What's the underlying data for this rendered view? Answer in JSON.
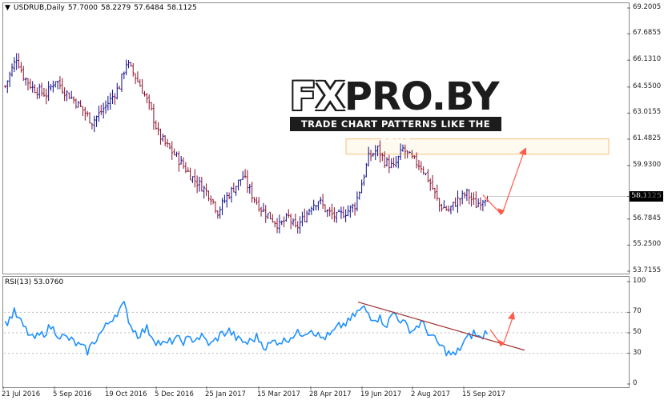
{
  "header": {
    "symbol": "USDRUB,Daily",
    "open": "57.7000",
    "high": "58.2279",
    "low": "57.6484",
    "close": "58.1125"
  },
  "rsi_header": {
    "label": "RSI(13) 53.0760"
  },
  "logo": {
    "main_left": "FX",
    "main_right": "PRO.BY",
    "tagline": "TRADE CHART PATTERNS LIKE THE PROS"
  },
  "price_tag": "58.1125",
  "colors": {
    "bull": "#0b0b8f",
    "bear": "#8b0f2c",
    "rsi": "#1e90ff",
    "trendline": "#a03030",
    "arrow": "#ff5a4a",
    "zone": "#f5c07a"
  },
  "chart_data": [
    {
      "type": "ohlc",
      "symbol": "USDRUB",
      "timeframe": "Daily",
      "ylim": [
        53.7155,
        69.2005
      ],
      "y_ticks": [
        "69.2005",
        "67.6855",
        "66.1310",
        "64.5500",
        "63.0155",
        "61.4825",
        "59.9300",
        "58.1125",
        "56.7845",
        "55.2500",
        "53.7155"
      ],
      "x_ticks": [
        "21 Jul 2016",
        "5 Sep 2016",
        "19 Oct 2016",
        "5 Dec 2016",
        "25 Jan 2017",
        "15 Mar 2017",
        "28 Apr 2017",
        "19 Jun 2017",
        "2 Aug 2017",
        "15 Sep 2017"
      ],
      "close_profile": [
        [
          0,
          64.6
        ],
        [
          5,
          66.3
        ],
        [
          8,
          65.2
        ],
        [
          12,
          64.5
        ],
        [
          18,
          64.1
        ],
        [
          22,
          65.0
        ],
        [
          26,
          64.3
        ],
        [
          30,
          63.8
        ],
        [
          34,
          63.2
        ],
        [
          38,
          62.5
        ],
        [
          42,
          63.1
        ],
        [
          46,
          63.8
        ],
        [
          50,
          64.6
        ],
        [
          53,
          66.0
        ],
        [
          56,
          65.4
        ],
        [
          60,
          64.4
        ],
        [
          64,
          63.1
        ],
        [
          67,
          61.8
        ],
        [
          70,
          61.2
        ],
        [
          74,
          60.6
        ],
        [
          78,
          59.9
        ],
        [
          82,
          59.2
        ],
        [
          86,
          58.7
        ],
        [
          90,
          58.1
        ],
        [
          93,
          57.2
        ],
        [
          97,
          58.1
        ],
        [
          100,
          58.6
        ],
        [
          104,
          59.3
        ],
        [
          108,
          58.2
        ],
        [
          112,
          57.4
        ],
        [
          116,
          56.9
        ],
        [
          120,
          56.4
        ],
        [
          124,
          56.9
        ],
        [
          127,
          56.2
        ],
        [
          131,
          56.9
        ],
        [
          134,
          57.6
        ],
        [
          137,
          57.9
        ],
        [
          141,
          57.2
        ],
        [
          145,
          56.9
        ],
        [
          149,
          57.2
        ],
        [
          153,
          57.6
        ],
        [
          156,
          58.9
        ],
        [
          159,
          60.4
        ],
        [
          163,
          60.9
        ],
        [
          166,
          60.2
        ],
        [
          170,
          59.8
        ],
        [
          174,
          60.9
        ],
        [
          178,
          60.3
        ],
        [
          182,
          59.9
        ],
        [
          186,
          58.9
        ],
        [
          190,
          57.6
        ],
        [
          194,
          57.3
        ],
        [
          198,
          57.9
        ],
        [
          202,
          58.3
        ],
        [
          206,
          57.6
        ],
        [
          210,
          58.1
        ]
      ],
      "resistance_zone": [
        60.6,
        61.5
      ],
      "forecast_path": [
        58.2,
        57.1,
        61.0
      ]
    },
    {
      "type": "line",
      "name": "RSI(13)",
      "current": 53.076,
      "ylim": [
        0,
        100
      ],
      "y_ticks": [
        "100",
        "70",
        "50",
        "30",
        "0"
      ],
      "levels": [
        70,
        50,
        30
      ],
      "profile": [
        [
          0,
          58
        ],
        [
          4,
          70
        ],
        [
          8,
          56
        ],
        [
          12,
          44
        ],
        [
          16,
          48
        ],
        [
          20,
          56
        ],
        [
          24,
          47
        ],
        [
          28,
          44
        ],
        [
          32,
          38
        ],
        [
          36,
          32
        ],
        [
          40,
          45
        ],
        [
          44,
          56
        ],
        [
          48,
          68
        ],
        [
          52,
          77
        ],
        [
          55,
          57
        ],
        [
          58,
          48
        ],
        [
          62,
          54
        ],
        [
          66,
          42
        ],
        [
          70,
          38
        ],
        [
          74,
          44
        ],
        [
          78,
          42
        ],
        [
          82,
          44
        ],
        [
          86,
          46
        ],
        [
          90,
          38
        ],
        [
          94,
          48
        ],
        [
          98,
          52
        ],
        [
          102,
          43
        ],
        [
          106,
          40
        ],
        [
          110,
          46
        ],
        [
          114,
          36
        ],
        [
          118,
          42
        ],
        [
          122,
          42
        ],
        [
          126,
          48
        ],
        [
          130,
          50
        ],
        [
          134,
          54
        ],
        [
          138,
          45
        ],
        [
          142,
          47
        ],
        [
          146,
          56
        ],
        [
          150,
          60
        ],
        [
          154,
          70
        ],
        [
          157,
          74
        ],
        [
          160,
          66
        ],
        [
          164,
          64
        ],
        [
          167,
          58
        ],
        [
          170,
          70
        ],
        [
          174,
          60
        ],
        [
          178,
          52
        ],
        [
          182,
          60
        ],
        [
          186,
          48
        ],
        [
          190,
          38
        ],
        [
          194,
          30
        ],
        [
          197,
          28
        ],
        [
          201,
          42
        ],
        [
          205,
          50
        ],
        [
          208,
          44
        ],
        [
          211,
          53
        ]
      ],
      "trendline": [
        80,
        33
      ],
      "forecast_path": [
        53,
        38,
        70
      ]
    }
  ]
}
